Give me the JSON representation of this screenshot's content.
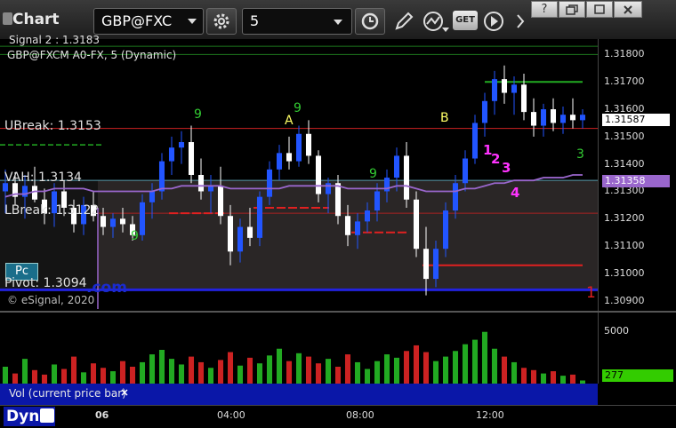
{
  "titlebar": {
    "title": "Chart",
    "symbol": "GBP@FXC",
    "interval": "5",
    "get_label": "GET",
    "help": "?"
  },
  "colors": {
    "up": "#2255ff",
    "down": "#ffffff",
    "ubreak": "#cc2222",
    "vah": "#5599aa",
    "lbreak": "#ee2222",
    "pivot": "#2222dd",
    "vwap": "#9966cc",
    "setup_count": "#33cc33",
    "point_labels": "#ffff66",
    "pivot_numbers": "#ff33ff"
  },
  "price_pane": {
    "header_cut": "Signal 2 : 1.3183",
    "symbol_line": "GBP@FXCM A0-FX, 5 (Dynamic)",
    "ubreak": "UBreak: 1.3153",
    "vah": "VAH: 1.3134",
    "lbreak": "LBreak: 1.3122",
    "pivot": "Pivot: 1.3094",
    "pc_badge": "Pc",
    "copyright": "© eSignal, 2020",
    "watermark": ".com",
    "last_price_tag": "1.31587",
    "vwap_tag": "1.31358",
    "marker_A": "A",
    "marker_B": "B",
    "num_1": "1",
    "num_2": "2",
    "num_3": "3",
    "num_4": "4",
    "num_red_1": "1",
    "setup_9a": "9",
    "setup_9b": "9",
    "setup_9c": "9",
    "setup_9d": "9",
    "setup_3": "3"
  },
  "price_axis": {
    "ticks": [
      "1.31800",
      "1.31700",
      "1.31600",
      "1.31500",
      "1.31400",
      "1.31300",
      "1.31200",
      "1.31100",
      "1.31000",
      "1.30900"
    ]
  },
  "volume_pane": {
    "label": "Vol (current price bar)",
    "tick": "5000",
    "current": "277"
  },
  "time_axis": {
    "dyn": "Dyn",
    "labels": [
      "06",
      "04:00",
      "08:00",
      "12:00"
    ]
  },
  "chart_data": {
    "type": "candlestick",
    "symbol": "GBP@FXCM",
    "ylim": [
      1.3087,
      1.3185
    ],
    "levels": {
      "UBreak": 1.3153,
      "VAH": 1.3134,
      "LBreak": 1.3122,
      "Pivot": 1.3094
    },
    "last": 1.31587,
    "vwap_last": 1.31358,
    "ohlc": [
      [
        1.313,
        1.3138,
        1.3122,
        1.3133
      ],
      [
        1.3133,
        1.3137,
        1.3125,
        1.3128
      ],
      [
        1.3128,
        1.3136,
        1.312,
        1.3132
      ],
      [
        1.3132,
        1.3139,
        1.3126,
        1.3127
      ],
      [
        1.3127,
        1.3131,
        1.3118,
        1.3122
      ],
      [
        1.3122,
        1.3133,
        1.3117,
        1.313
      ],
      [
        1.313,
        1.3134,
        1.3121,
        1.3124
      ],
      [
        1.3124,
        1.3127,
        1.3115,
        1.3118
      ],
      [
        1.3118,
        1.3128,
        1.3114,
        1.3125
      ],
      [
        1.3125,
        1.313,
        1.3119,
        1.3121
      ],
      [
        1.3121,
        1.3124,
        1.3114,
        1.3117
      ],
      [
        1.3117,
        1.3122,
        1.3113,
        1.312
      ],
      [
        1.312,
        1.3124,
        1.3115,
        1.3118
      ],
      [
        1.3118,
        1.3121,
        1.3112,
        1.3114
      ],
      [
        1.3114,
        1.3129,
        1.3112,
        1.3126
      ],
      [
        1.3126,
        1.3133,
        1.312,
        1.313
      ],
      [
        1.313,
        1.3144,
        1.3127,
        1.3141
      ],
      [
        1.3141,
        1.315,
        1.3136,
        1.3146
      ],
      [
        1.3146,
        1.3152,
        1.314,
        1.3148
      ],
      [
        1.3148,
        1.3154,
        1.3133,
        1.3136
      ],
      [
        1.3136,
        1.3142,
        1.3127,
        1.313
      ],
      [
        1.313,
        1.3136,
        1.3122,
        1.3132
      ],
      [
        1.3132,
        1.3139,
        1.3118,
        1.3121
      ],
      [
        1.3121,
        1.3125,
        1.3103,
        1.3108
      ],
      [
        1.3108,
        1.312,
        1.3104,
        1.3117
      ],
      [
        1.3117,
        1.3124,
        1.311,
        1.3113
      ],
      [
        1.3113,
        1.313,
        1.311,
        1.3128
      ],
      [
        1.3128,
        1.3141,
        1.3125,
        1.3138
      ],
      [
        1.3138,
        1.3147,
        1.3134,
        1.3144
      ],
      [
        1.3144,
        1.315,
        1.3138,
        1.3141
      ],
      [
        1.3141,
        1.3154,
        1.3139,
        1.3151
      ],
      [
        1.3151,
        1.3156,
        1.314,
        1.3143
      ],
      [
        1.3143,
        1.3145,
        1.3126,
        1.3129
      ],
      [
        1.3129,
        1.3135,
        1.3122,
        1.3133
      ],
      [
        1.3133,
        1.3136,
        1.3118,
        1.3121
      ],
      [
        1.3121,
        1.3125,
        1.311,
        1.3114
      ],
      [
        1.3114,
        1.3122,
        1.3109,
        1.3119
      ],
      [
        1.3119,
        1.3126,
        1.3115,
        1.3123
      ],
      [
        1.3123,
        1.3133,
        1.3119,
        1.313
      ],
      [
        1.313,
        1.3138,
        1.3126,
        1.3135
      ],
      [
        1.3135,
        1.3146,
        1.313,
        1.3143
      ],
      [
        1.3143,
        1.3148,
        1.3124,
        1.3127
      ],
      [
        1.3127,
        1.313,
        1.3106,
        1.3109
      ],
      [
        1.3109,
        1.3117,
        1.3092,
        1.3098
      ],
      [
        1.3098,
        1.3112,
        1.3095,
        1.3109
      ],
      [
        1.3109,
        1.3126,
        1.3106,
        1.3123
      ],
      [
        1.3123,
        1.3136,
        1.312,
        1.3133
      ],
      [
        1.3133,
        1.3145,
        1.313,
        1.3142
      ],
      [
        1.3142,
        1.3158,
        1.314,
        1.3155
      ],
      [
        1.3155,
        1.3166,
        1.315,
        1.3163
      ],
      [
        1.3163,
        1.3174,
        1.3158,
        1.3171
      ],
      [
        1.3171,
        1.3176,
        1.3162,
        1.3166
      ],
      [
        1.3166,
        1.3172,
        1.3158,
        1.3169
      ],
      [
        1.3169,
        1.3173,
        1.3156,
        1.3159
      ],
      [
        1.3159,
        1.3164,
        1.315,
        1.3154
      ],
      [
        1.3154,
        1.3162,
        1.315,
        1.316
      ],
      [
        1.316,
        1.3164,
        1.3152,
        1.3155
      ],
      [
        1.3155,
        1.3161,
        1.3151,
        1.3158
      ],
      [
        1.3158,
        1.3164,
        1.3153,
        1.3156
      ],
      [
        1.3156,
        1.316,
        1.3153,
        1.3158
      ]
    ],
    "vwap": [
      1.3128,
      1.3129,
      1.3129,
      1.313,
      1.313,
      1.3131,
      1.3131,
      1.3131,
      1.3131,
      1.313,
      1.313,
      1.313,
      1.313,
      1.313,
      1.313,
      1.313,
      1.3131,
      1.3131,
      1.3132,
      1.3132,
      1.3132,
      1.3132,
      1.3132,
      1.3131,
      1.3131,
      1.3131,
      1.3131,
      1.3131,
      1.3131,
      1.3132,
      1.3132,
      1.3132,
      1.3132,
      1.3132,
      1.3132,
      1.3131,
      1.3131,
      1.3131,
      1.3131,
      1.3131,
      1.3132,
      1.3132,
      1.3131,
      1.313,
      1.313,
      1.313,
      1.313,
      1.3131,
      1.3131,
      1.3132,
      1.3133,
      1.3133,
      1.3134,
      1.3134,
      1.3134,
      1.3135,
      1.3135,
      1.3135,
      1.3136,
      1.3136
    ],
    "volume": [
      1500,
      900,
      2200,
      1200,
      800,
      1700,
      1300,
      2400,
      1000,
      1800,
      1400,
      1100,
      2000,
      1500,
      1900,
      2600,
      3000,
      2200,
      1700,
      2400,
      1900,
      1400,
      2100,
      2800,
      1600,
      2300,
      1800,
      2500,
      3100,
      2000,
      2700,
      2400,
      1800,
      2200,
      1500,
      2600,
      1900,
      1300,
      2000,
      2600,
      2300,
      2900,
      3400,
      2800,
      2000,
      2400,
      2900,
      3500,
      3900,
      4600,
      3100,
      2400,
      1900,
      1400,
      1200,
      900,
      1100,
      700,
      800,
      277
    ],
    "volume_max": 6000
  }
}
